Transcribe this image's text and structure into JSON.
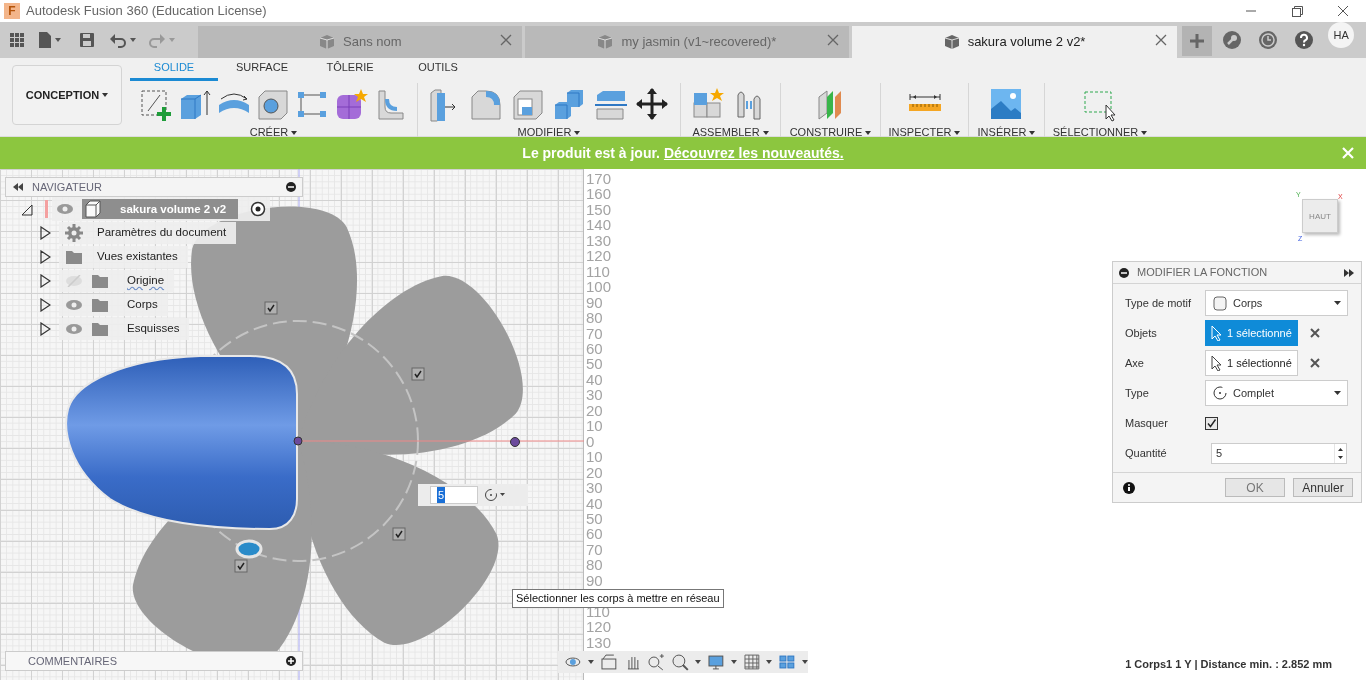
{
  "window": {
    "logo": "F",
    "title": "Autodesk Fusion 360 (Education License)"
  },
  "document_tabs": [
    {
      "label": "Sans nom",
      "selected": false
    },
    {
      "label": "my jasmin (v1~recovered)*",
      "selected": false
    },
    {
      "label": "sakura volume 2 v2*",
      "selected": true
    }
  ],
  "user": {
    "initials": "HA"
  },
  "workspace": {
    "label": "CONCEPTION"
  },
  "ribbon_tabs": [
    {
      "label": "SOLIDE",
      "selected": true
    },
    {
      "label": "SURFACE",
      "selected": false
    },
    {
      "label": "TÔLERIE",
      "selected": false
    },
    {
      "label": "OUTILS",
      "selected": false
    }
  ],
  "ribbon_groups": [
    {
      "label": "CRÉER"
    },
    {
      "label": "MODIFIER"
    },
    {
      "label": "ASSEMBLER"
    },
    {
      "label": "CONSTRUIRE"
    },
    {
      "label": "INSPECTER"
    },
    {
      "label": "INSÉRER"
    },
    {
      "label": "SÉLECTIONNER"
    }
  ],
  "banner": {
    "message": "Le produit est à jour.",
    "link": "Découvrez les nouveautés."
  },
  "navigator": {
    "title": "NAVIGATEUR",
    "tree": [
      {
        "label": "sakura volume 2 v2",
        "kind": "document",
        "expanded": true,
        "visible": true,
        "children": [
          {
            "label": "Paramètres du document",
            "kind": "settings",
            "expanded": false
          },
          {
            "label": "Vues existantes",
            "kind": "folder",
            "expanded": false
          },
          {
            "label": "Origine",
            "kind": "folder",
            "expanded": false,
            "visible": false
          },
          {
            "label": "Corps",
            "kind": "folder",
            "expanded": false,
            "visible": true
          },
          {
            "label": "Esquisses",
            "kind": "folder",
            "expanded": false,
            "visible": true
          }
        ]
      }
    ]
  },
  "canvas": {
    "quantity_input": {
      "value": "5"
    },
    "tooltip": "Sélectionner les corps à mettre en réseau",
    "ruler_upper": [
      "170",
      "160",
      "150",
      "140",
      "130",
      "120",
      "110",
      "100",
      "90",
      "80",
      "70",
      "60",
      "50",
      "40",
      "30",
      "20",
      "10",
      "0",
      "10",
      "20",
      "30",
      "40",
      "50",
      "60",
      "70",
      "80",
      "90"
    ],
    "ruler_lower": [
      "110",
      "120",
      "130"
    ],
    "view_cube": {
      "face": "HAUT",
      "axes": [
        "Y",
        "X",
        "Z"
      ]
    }
  },
  "dialog": {
    "title": "MODIFIER LA FONCTION",
    "fields": [
      {
        "label": "Type de motif",
        "kind": "dropdown",
        "value": "Corps"
      },
      {
        "label": "Objets",
        "kind": "selection",
        "value": "1 sélectionné",
        "selected": true
      },
      {
        "label": "Axe",
        "kind": "selection",
        "value": "1 sélectionné",
        "selected": false
      },
      {
        "label": "Type",
        "kind": "dropdown",
        "value": "Complet"
      },
      {
        "label": "Masquer",
        "kind": "checkbox",
        "checked": true
      },
      {
        "label": "Quantité",
        "kind": "number",
        "value": "5"
      }
    ],
    "buttons": [
      "OK",
      "Annuler"
    ]
  },
  "comments": {
    "title": "COMMENTAIRES"
  },
  "status_bar": {
    "text": "1 Corps1 1 Y | Distance min. : 2.852 mm"
  }
}
